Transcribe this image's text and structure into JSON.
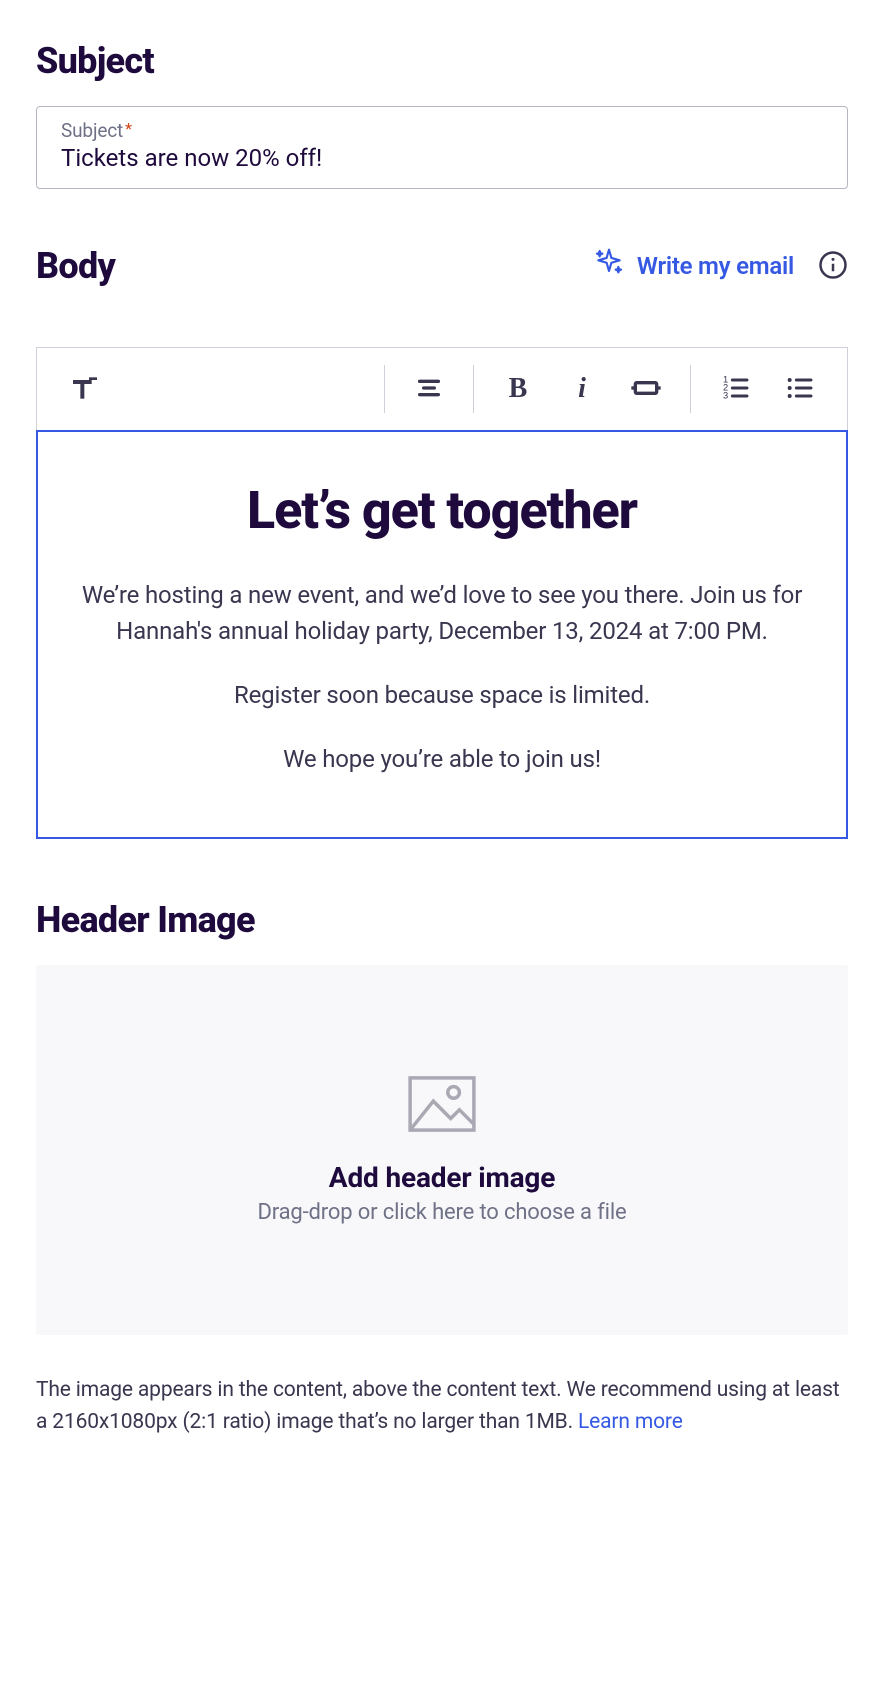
{
  "subject": {
    "heading": "Subject",
    "label": "Subject",
    "required_marker": "*",
    "value": "Tickets are now 20% off!"
  },
  "body": {
    "heading": "Body",
    "write_email_label": "Write my email",
    "content": {
      "title": "Let’s get together",
      "p1": "We’re hosting a new event, and we’d love to see you there. Join us for Hannah's annual holiday party, December 13, 2024 at 7:00 PM.",
      "p2": "Register soon because space is limited.",
      "p3": "We hope you’re able to join us!"
    }
  },
  "header_image": {
    "heading": "Header Image",
    "dropzone_title": "Add header image",
    "dropzone_sub": "Drag-drop or click here to choose a file",
    "caption_text": "The image appears in the content, above the content text. We recommend using at least a 2160x1080px (2:1 ratio) image that’s no larger than 1MB. ",
    "learn_more": "Learn more"
  }
}
